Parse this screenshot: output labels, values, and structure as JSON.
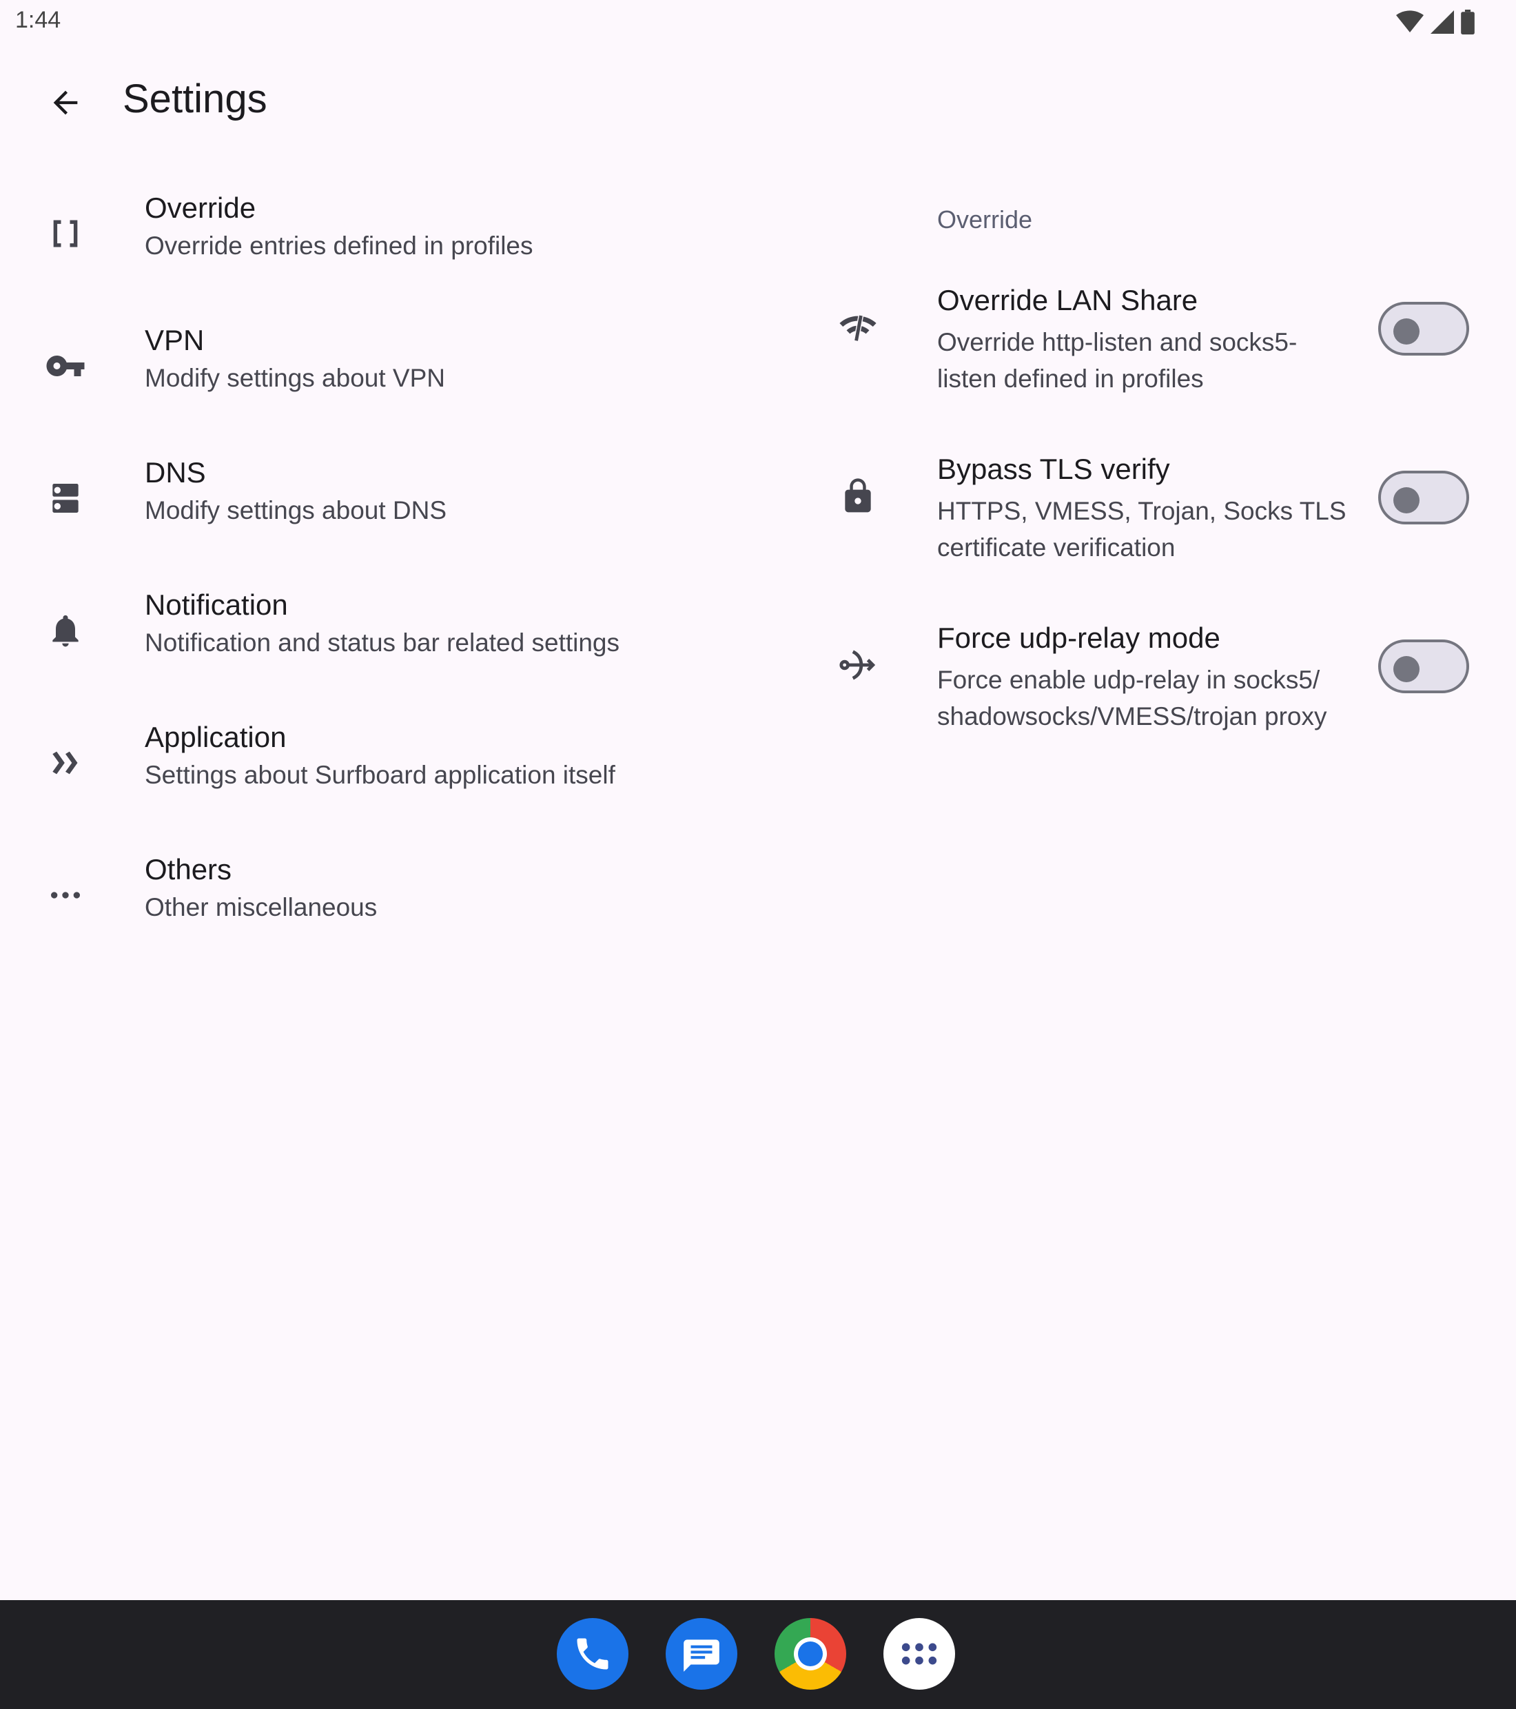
{
  "status_bar": {
    "time": "1:44",
    "icons": [
      "wifi-icon",
      "cell-signal-icon",
      "battery-icon"
    ]
  },
  "app_bar": {
    "back_icon": "arrow-back-icon",
    "title": "Settings"
  },
  "categories": [
    {
      "icon": "brackets-icon",
      "title": "Override",
      "subtitle": "Override entries defined in profiles"
    },
    {
      "icon": "key-icon",
      "title": "VPN",
      "subtitle": "Modify settings about VPN"
    },
    {
      "icon": "dns-icon",
      "title": "DNS",
      "subtitle": "Modify settings about DNS"
    },
    {
      "icon": "bell-icon",
      "title": "Notification",
      "subtitle": "Notification and status bar related settings"
    },
    {
      "icon": "double-chevron-icon",
      "title": "Application",
      "subtitle": "Settings about Surfboard application itself"
    },
    {
      "icon": "more-horiz-icon",
      "title": "Others",
      "subtitle": "Other miscellaneous"
    }
  ],
  "override_panel": {
    "section_title": "Override",
    "items": [
      {
        "icon": "wifi-share-icon",
        "title": "Override LAN Share",
        "subtitle": "Override http-listen and socks5-listen defined in profiles",
        "enabled": false
      },
      {
        "icon": "lock-icon",
        "title": "Bypass TLS verify",
        "subtitle": "HTTPS, VMESS, Trojan, Socks TLS certificate verification",
        "enabled": false
      },
      {
        "icon": "relay-icon",
        "title": "Force udp-relay mode",
        "subtitle": "Force enable udp-relay in socks5/ shadowsocks/VMESS/trojan proxy",
        "enabled": false
      }
    ]
  },
  "dock": [
    "phone-app",
    "messages-app",
    "chrome-app",
    "app-drawer"
  ],
  "colors": {
    "background": "#fdf8fd",
    "icon": "#46464f",
    "switch_outline": "#74757f",
    "nav_bar": "#202024"
  }
}
